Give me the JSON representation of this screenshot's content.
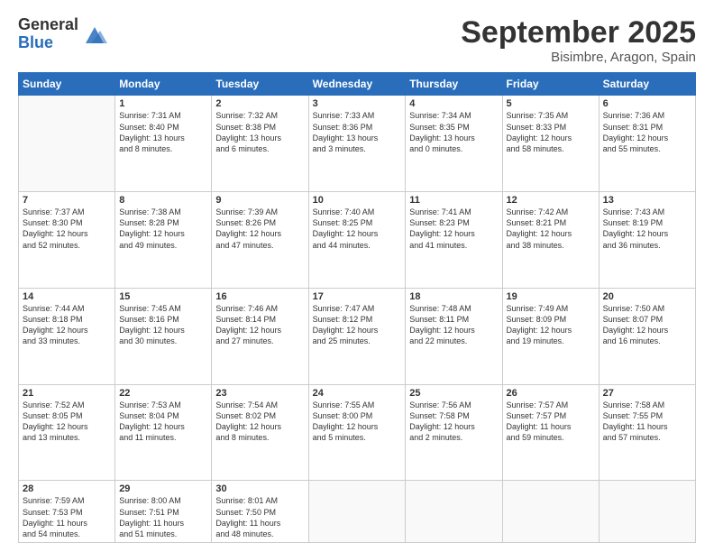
{
  "logo": {
    "general": "General",
    "blue": "Blue"
  },
  "title": "September 2025",
  "subtitle": "Bisimbre, Aragon, Spain",
  "days_header": [
    "Sunday",
    "Monday",
    "Tuesday",
    "Wednesday",
    "Thursday",
    "Friday",
    "Saturday"
  ],
  "weeks": [
    [
      {
        "num": "",
        "info": ""
      },
      {
        "num": "1",
        "info": "Sunrise: 7:31 AM\nSunset: 8:40 PM\nDaylight: 13 hours\nand 8 minutes."
      },
      {
        "num": "2",
        "info": "Sunrise: 7:32 AM\nSunset: 8:38 PM\nDaylight: 13 hours\nand 6 minutes."
      },
      {
        "num": "3",
        "info": "Sunrise: 7:33 AM\nSunset: 8:36 PM\nDaylight: 13 hours\nand 3 minutes."
      },
      {
        "num": "4",
        "info": "Sunrise: 7:34 AM\nSunset: 8:35 PM\nDaylight: 13 hours\nand 0 minutes."
      },
      {
        "num": "5",
        "info": "Sunrise: 7:35 AM\nSunset: 8:33 PM\nDaylight: 12 hours\nand 58 minutes."
      },
      {
        "num": "6",
        "info": "Sunrise: 7:36 AM\nSunset: 8:31 PM\nDaylight: 12 hours\nand 55 minutes."
      }
    ],
    [
      {
        "num": "7",
        "info": "Sunrise: 7:37 AM\nSunset: 8:30 PM\nDaylight: 12 hours\nand 52 minutes."
      },
      {
        "num": "8",
        "info": "Sunrise: 7:38 AM\nSunset: 8:28 PM\nDaylight: 12 hours\nand 49 minutes."
      },
      {
        "num": "9",
        "info": "Sunrise: 7:39 AM\nSunset: 8:26 PM\nDaylight: 12 hours\nand 47 minutes."
      },
      {
        "num": "10",
        "info": "Sunrise: 7:40 AM\nSunset: 8:25 PM\nDaylight: 12 hours\nand 44 minutes."
      },
      {
        "num": "11",
        "info": "Sunrise: 7:41 AM\nSunset: 8:23 PM\nDaylight: 12 hours\nand 41 minutes."
      },
      {
        "num": "12",
        "info": "Sunrise: 7:42 AM\nSunset: 8:21 PM\nDaylight: 12 hours\nand 38 minutes."
      },
      {
        "num": "13",
        "info": "Sunrise: 7:43 AM\nSunset: 8:19 PM\nDaylight: 12 hours\nand 36 minutes."
      }
    ],
    [
      {
        "num": "14",
        "info": "Sunrise: 7:44 AM\nSunset: 8:18 PM\nDaylight: 12 hours\nand 33 minutes."
      },
      {
        "num": "15",
        "info": "Sunrise: 7:45 AM\nSunset: 8:16 PM\nDaylight: 12 hours\nand 30 minutes."
      },
      {
        "num": "16",
        "info": "Sunrise: 7:46 AM\nSunset: 8:14 PM\nDaylight: 12 hours\nand 27 minutes."
      },
      {
        "num": "17",
        "info": "Sunrise: 7:47 AM\nSunset: 8:12 PM\nDaylight: 12 hours\nand 25 minutes."
      },
      {
        "num": "18",
        "info": "Sunrise: 7:48 AM\nSunset: 8:11 PM\nDaylight: 12 hours\nand 22 minutes."
      },
      {
        "num": "19",
        "info": "Sunrise: 7:49 AM\nSunset: 8:09 PM\nDaylight: 12 hours\nand 19 minutes."
      },
      {
        "num": "20",
        "info": "Sunrise: 7:50 AM\nSunset: 8:07 PM\nDaylight: 12 hours\nand 16 minutes."
      }
    ],
    [
      {
        "num": "21",
        "info": "Sunrise: 7:52 AM\nSunset: 8:05 PM\nDaylight: 12 hours\nand 13 minutes."
      },
      {
        "num": "22",
        "info": "Sunrise: 7:53 AM\nSunset: 8:04 PM\nDaylight: 12 hours\nand 11 minutes."
      },
      {
        "num": "23",
        "info": "Sunrise: 7:54 AM\nSunset: 8:02 PM\nDaylight: 12 hours\nand 8 minutes."
      },
      {
        "num": "24",
        "info": "Sunrise: 7:55 AM\nSunset: 8:00 PM\nDaylight: 12 hours\nand 5 minutes."
      },
      {
        "num": "25",
        "info": "Sunrise: 7:56 AM\nSunset: 7:58 PM\nDaylight: 12 hours\nand 2 minutes."
      },
      {
        "num": "26",
        "info": "Sunrise: 7:57 AM\nSunset: 7:57 PM\nDaylight: 11 hours\nand 59 minutes."
      },
      {
        "num": "27",
        "info": "Sunrise: 7:58 AM\nSunset: 7:55 PM\nDaylight: 11 hours\nand 57 minutes."
      }
    ],
    [
      {
        "num": "28",
        "info": "Sunrise: 7:59 AM\nSunset: 7:53 PM\nDaylight: 11 hours\nand 54 minutes."
      },
      {
        "num": "29",
        "info": "Sunrise: 8:00 AM\nSunset: 7:51 PM\nDaylight: 11 hours\nand 51 minutes."
      },
      {
        "num": "30",
        "info": "Sunrise: 8:01 AM\nSunset: 7:50 PM\nDaylight: 11 hours\nand 48 minutes."
      },
      {
        "num": "",
        "info": ""
      },
      {
        "num": "",
        "info": ""
      },
      {
        "num": "",
        "info": ""
      },
      {
        "num": "",
        "info": ""
      }
    ]
  ]
}
